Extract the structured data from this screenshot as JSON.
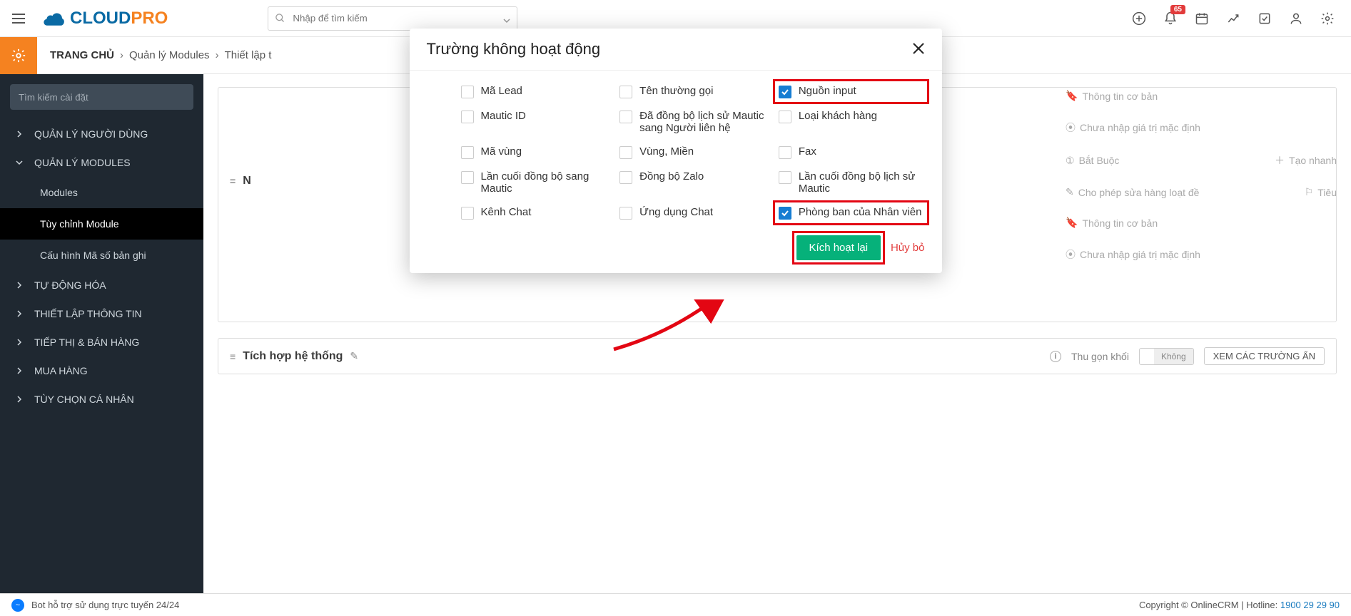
{
  "topbar": {
    "search_placeholder": "Nhập để tìm kiếm",
    "notif_count": "65"
  },
  "logo": {
    "cloud": "CLOUD",
    "pro": "PRO"
  },
  "breadcrumb": {
    "root": "TRANG CHỦ",
    "items": [
      "Quản lý Modules",
      "Thiết lập t"
    ]
  },
  "sidebar": {
    "search_placeholder": "Tìm kiếm cài đặt",
    "sections": [
      {
        "label": "QUẢN LÝ NGƯỜI DÙNG",
        "expanded": false
      },
      {
        "label": "QUẢN LÝ MODULES",
        "expanded": true,
        "children": [
          {
            "label": "Modules"
          },
          {
            "label": "Tùy chỉnh Module",
            "active": true
          },
          {
            "label": "Cấu hình Mã số bản ghi"
          }
        ]
      },
      {
        "label": "TỰ ĐỘNG HÓA",
        "expanded": false
      },
      {
        "label": "THIẾT LẬP THÔNG TIN",
        "expanded": false
      },
      {
        "label": "TIẾP THỊ & BÁN HÀNG",
        "expanded": false
      },
      {
        "label": "MUA HÀNG",
        "expanded": false
      },
      {
        "label": "TÙY CHỌN CÁ NHÂN",
        "expanded": false
      }
    ]
  },
  "ghost": {
    "items": [
      "Thông tin cơ bản",
      "Chưa nhập giá trị mặc định",
      "Bắt Buộc",
      "Tạo nhanh",
      "Cho phép sửa hàng loạt đề",
      "Tiêu",
      "Thông tin cơ bản",
      "Chưa nhập giá trị mặc định"
    ]
  },
  "block": {
    "drag": "=",
    "title_prefix": "N",
    "title": "Tích hợp hệ thống",
    "collapse_label": "Thu gọn khối",
    "toggle_off": "Không",
    "hidden_btn": "XEM CÁC TRƯỜNG ẨN"
  },
  "footer": {
    "bot": "Bot hỗ trợ sử dụng trực tuyến 24/24",
    "copyright": "Copyright © OnlineCRM | Hotline: ",
    "hotline": "1900 29 29 90"
  },
  "modal": {
    "title": "Trường không hoạt động",
    "fields": [
      {
        "label": "Mã Lead",
        "checked": false
      },
      {
        "label": "Tên thường gọi",
        "checked": false
      },
      {
        "label": "Nguồn input",
        "checked": true,
        "anno": true
      },
      {
        "label": "Mautic ID",
        "checked": false
      },
      {
        "label": "Đã đồng bộ lịch sử Mautic sang Người liên hệ",
        "checked": false
      },
      {
        "label": "Loại khách hàng",
        "checked": false
      },
      {
        "label": "Mã vùng",
        "checked": false
      },
      {
        "label": "Vùng, Miền",
        "checked": false
      },
      {
        "label": "Fax",
        "checked": false
      },
      {
        "label": "Lần cuối đồng bộ sang Mautic",
        "checked": false
      },
      {
        "label": "Đồng bộ Zalo",
        "checked": false
      },
      {
        "label": "Lần cuối đồng bộ lịch sử Mautic",
        "checked": false
      },
      {
        "label": "Kênh Chat",
        "checked": false
      },
      {
        "label": "Ứng dụng Chat",
        "checked": false
      },
      {
        "label": "Phòng ban của Nhân viên",
        "checked": true,
        "anno": true
      }
    ],
    "primary": "Kích hoạt lại",
    "cancel": "Hủy bỏ"
  }
}
